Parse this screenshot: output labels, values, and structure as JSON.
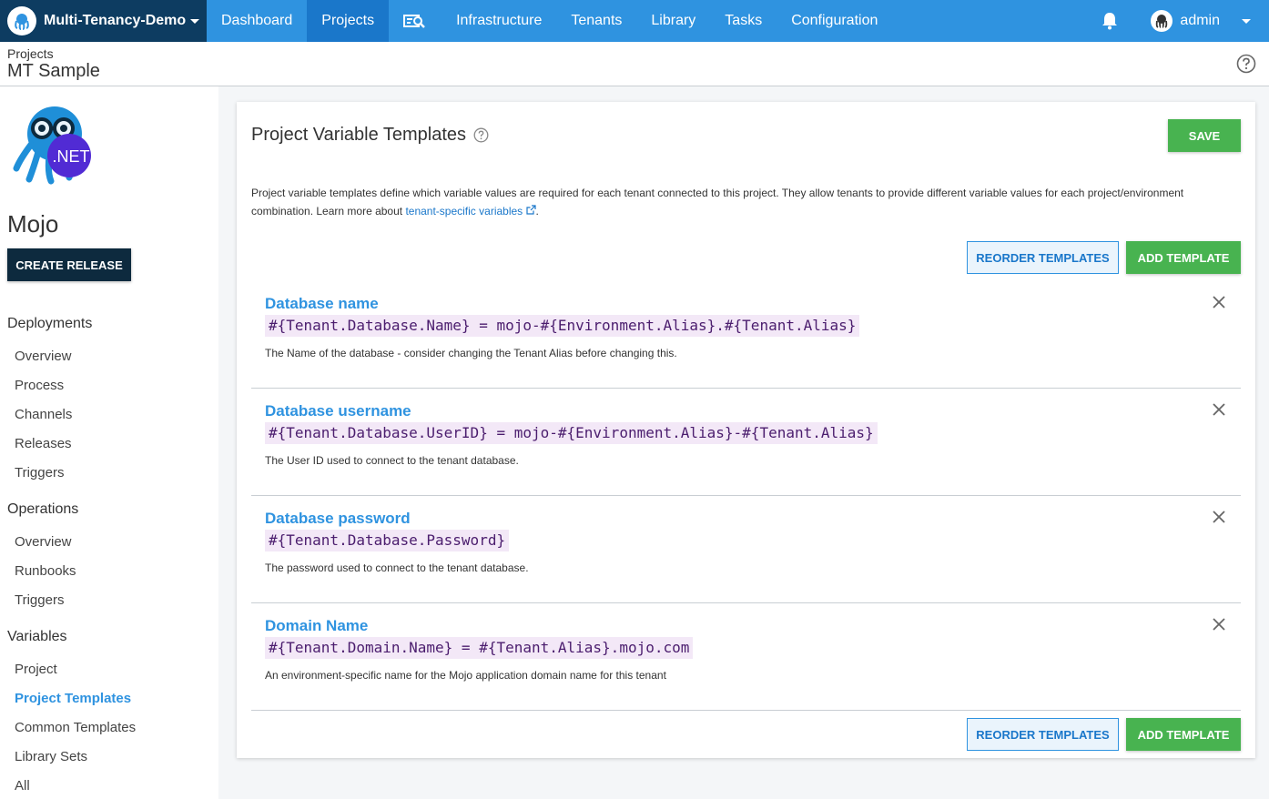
{
  "topnav": {
    "space_name": "Multi-Tenancy-Demo",
    "items": [
      {
        "label": "Dashboard"
      },
      {
        "label": "Projects"
      },
      {
        "label": "Infrastructure"
      },
      {
        "label": "Tenants"
      },
      {
        "label": "Library"
      },
      {
        "label": "Tasks"
      },
      {
        "label": "Configuration"
      }
    ],
    "active_item": "Projects",
    "user": "admin"
  },
  "header": {
    "breadcrumb": "Projects",
    "title": "MT Sample"
  },
  "sidebar": {
    "logo_text": ".NET",
    "project_name": "Mojo",
    "create_release": "CREATE RELEASE",
    "groups": [
      {
        "label": "Deployments",
        "items": [
          "Overview",
          "Process",
          "Channels",
          "Releases",
          "Triggers"
        ]
      },
      {
        "label": "Operations",
        "items": [
          "Overview",
          "Runbooks",
          "Triggers"
        ]
      },
      {
        "label": "Variables",
        "items": [
          "Project",
          "Project Templates",
          "Common Templates",
          "Library Sets",
          "All"
        ]
      }
    ],
    "active_item": "Project Templates"
  },
  "main": {
    "title": "Project Variable Templates",
    "save": "SAVE",
    "intro_text": "Project variable templates define which variable values are required for each tenant connected to this project. They allow tenants to provide different variable values for each project/environment combination. Learn more about ",
    "intro_link": "tenant-specific variables",
    "intro_end": ".",
    "reorder": "REORDER TEMPLATES",
    "add": "ADD TEMPLATE",
    "templates": [
      {
        "name": "Database name",
        "expression": "#{Tenant.Database.Name} = mojo-#{Environment.Alias}.#{Tenant.Alias}",
        "description": "The Name of the database - consider changing the Tenant Alias before changing this."
      },
      {
        "name": "Database username",
        "expression": "#{Tenant.Database.UserID} = mojo-#{Environment.Alias}-#{Tenant.Alias}",
        "description": "The User ID used to connect to the tenant database."
      },
      {
        "name": "Database password",
        "expression": "#{Tenant.Database.Password}",
        "description": "The password used to connect to the tenant database."
      },
      {
        "name": "Domain Name",
        "expression": "#{Tenant.Domain.Name} = #{Tenant.Alias}.mojo.com",
        "description": "An environment-specific name for the Mojo application domain name for this tenant"
      }
    ]
  },
  "colors": {
    "nav_blue": "#2f93e0",
    "nav_active": "#1a77ca",
    "space_bg": "#0d3c61",
    "green": "#48b350",
    "expr_bg": "#f3e8f7",
    "expr_text": "#4b1d6e"
  }
}
